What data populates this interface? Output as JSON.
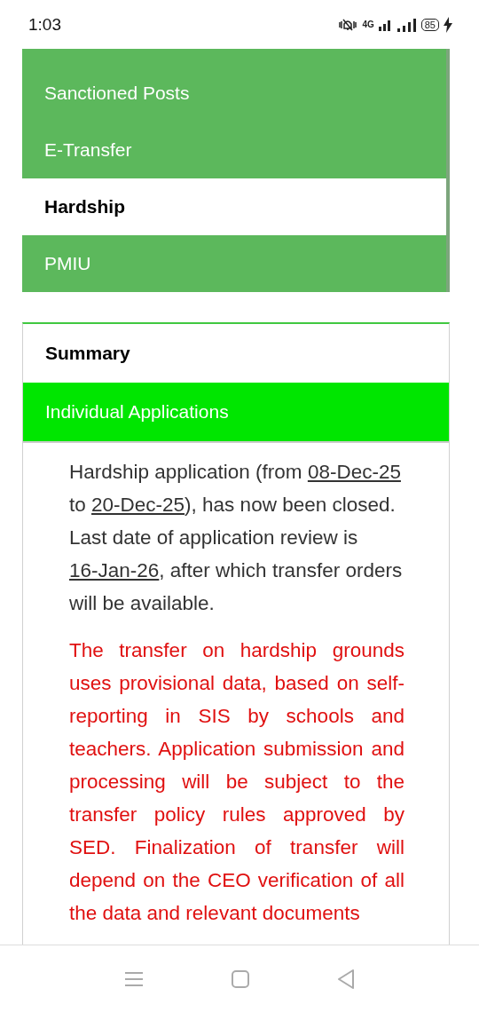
{
  "status_bar": {
    "time": "1:03",
    "network": "4G",
    "battery": "85"
  },
  "menu": [
    {
      "label": "Sanctioned Posts",
      "selected": false
    },
    {
      "label": "E-Transfer",
      "selected": false
    },
    {
      "label": "Hardship",
      "selected": true
    },
    {
      "label": "PMIU",
      "selected": false
    }
  ],
  "tabs": [
    {
      "label": "Summary",
      "selected": false
    },
    {
      "label": "Individual Applications",
      "selected": true
    }
  ],
  "paragraphs": [
    {
      "kind": "info",
      "parts": [
        {
          "text": "Hardship application (from ",
          "kind": "text"
        },
        {
          "text": "08-Dec-25",
          "kind": "link"
        },
        {
          "text": " to ",
          "kind": "text"
        },
        {
          "text": "20-Dec-25",
          "kind": "link"
        },
        {
          "text": "), has now been closed. Last date of application review is ",
          "kind": "text"
        },
        {
          "text": "16-Jan-26",
          "kind": "link"
        },
        {
          "text": ", after which transfer orders will be available.",
          "kind": "text"
        }
      ]
    },
    {
      "kind": "warning",
      "parts": [
        {
          "text": "The transfer on hardship grounds uses provisional data, based on self-reporting in SIS by schools and teachers. Application submission and processing will be subject to the transfer policy rules approved by SED. Finalization of transfer will depend on the CEO verification of all the data and relevant documents",
          "kind": "text"
        }
      ]
    }
  ]
}
